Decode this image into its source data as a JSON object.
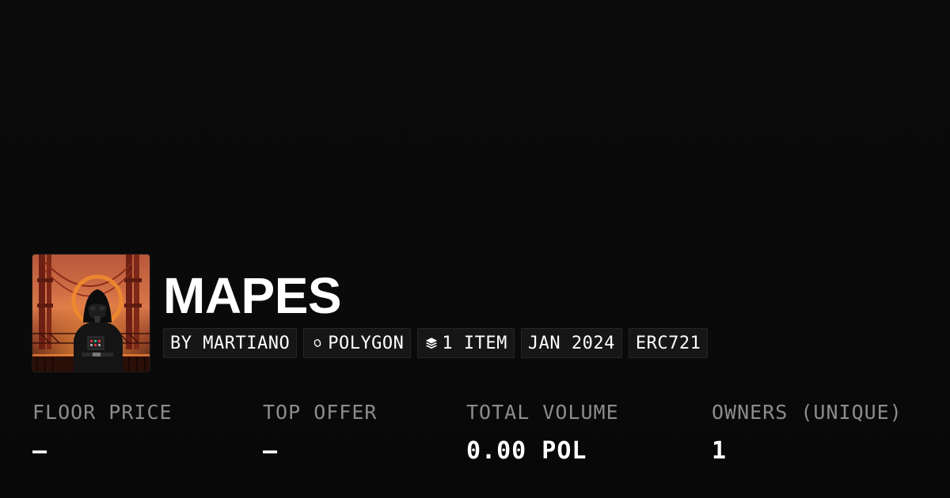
{
  "collection": {
    "title": "MAPES",
    "avatar_icon": "collection-avatar-image",
    "badges": [
      {
        "name": "creator",
        "label": "BY MARTIANO",
        "icon": ""
      },
      {
        "name": "chain",
        "label": "POLYGON",
        "icon": "polygon-icon"
      },
      {
        "name": "items",
        "label": "1 ITEM",
        "icon": "layers-icon"
      },
      {
        "name": "date",
        "label": "JAN 2024",
        "icon": ""
      },
      {
        "name": "standard",
        "label": "ERC721",
        "icon": ""
      }
    ]
  },
  "stats": [
    {
      "label": "FLOOR PRICE",
      "value": "–"
    },
    {
      "label": "TOP OFFER",
      "value": "–"
    },
    {
      "label": "TOTAL VOLUME",
      "value": "0.00 POL"
    },
    {
      "label": "OWNERS (UNIQUE)",
      "value": "1"
    }
  ],
  "colors": {
    "background": "#0a0a0a",
    "badge_background": "#161616",
    "badge_border": "#262626",
    "label_gray": "#8c8c8c",
    "text": "#ffffff"
  }
}
